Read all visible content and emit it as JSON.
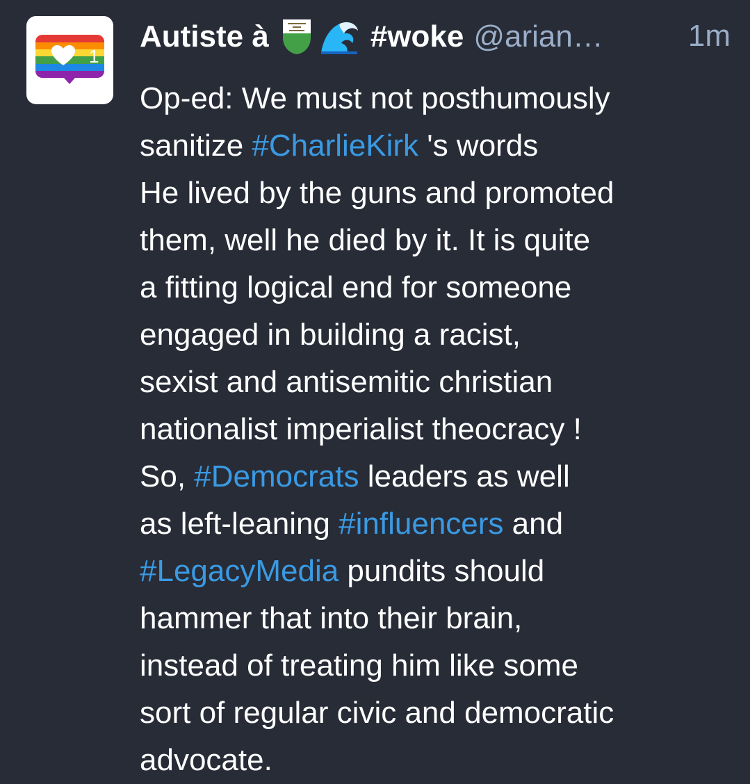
{
  "post": {
    "avatar": {
      "icon": "rainbow-heart-speech-bubble-icon",
      "count": "1"
    },
    "header": {
      "display_name": "Autiste à",
      "flag_icon": "vaud-flag-icon",
      "wave_icon": "water-wave-emoji",
      "name_tag": "#woke",
      "handle": "@arian…",
      "time": "1m"
    },
    "content": {
      "line1": "Op-ed: We must not posthumously",
      "line2_before": "sanitize ",
      "line2_tag": "#CharlieKirk",
      "line2_after": " 's words",
      "line3": "He lived by the guns and promoted",
      "line4": "them, well he died by it. It is quite",
      "line5": "a fitting logical end for someone",
      "line6": "engaged in building a racist,",
      "line7": "sexist and antisemitic christian",
      "line8": "nationalist imperialist theocracy !",
      "line9_before": "So, ",
      "line9_tag": "#Democrats",
      "line9_after": " leaders as well",
      "line10_before": "as left-leaning ",
      "line10_tag": "#influencers",
      "line10_after": " and",
      "line11_tag": "#LegacyMedia",
      "line11_after": " pundits should",
      "line12": "hammer that into their brain,",
      "line13": "instead of treating him like some",
      "line14": "sort of regular civic and democratic",
      "line15": "advocate."
    },
    "colors": {
      "background": "#282c37",
      "text": "#ffffff",
      "muted": "#9baec8",
      "hashtag": "#3a9ae3"
    }
  }
}
